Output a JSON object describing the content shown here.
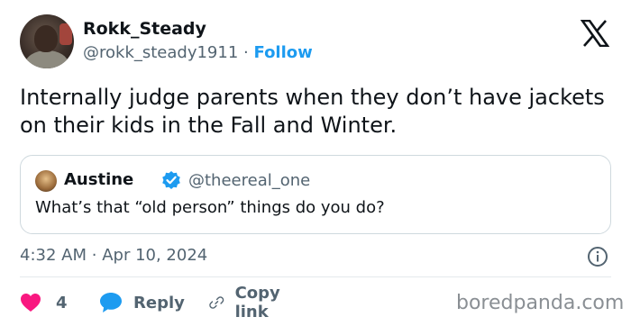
{
  "author": {
    "name": "Rokk_Steady",
    "handle": "@rokk_steady1911",
    "separator": "·",
    "follow_label": "Follow"
  },
  "tweet": {
    "text": "Internally judge parents when they don’t have jackets on their kids in the Fall and Winter.",
    "time": "4:32 AM",
    "date": "Apr 10, 2024",
    "meta_separator": "·"
  },
  "quoted": {
    "name": "Austine",
    "handle": "@theereal_one",
    "text": "What’s that “old person” things do you do?",
    "verified_color": "#1d9bf0"
  },
  "actions": {
    "like_count": "4",
    "reply_label": "Reply",
    "copy_label": "Copy link"
  },
  "icons": {
    "platform": "x-logo-icon",
    "like": "heart-icon",
    "reply": "speech-bubble-icon",
    "copy": "link-icon",
    "info": "info-icon",
    "verified": "verified-badge-icon"
  },
  "colors": {
    "accent": "#1d9bf0",
    "like": "#f91880",
    "text": "#0f1419",
    "secondary": "#536471"
  },
  "watermark": "boredpanda.com"
}
